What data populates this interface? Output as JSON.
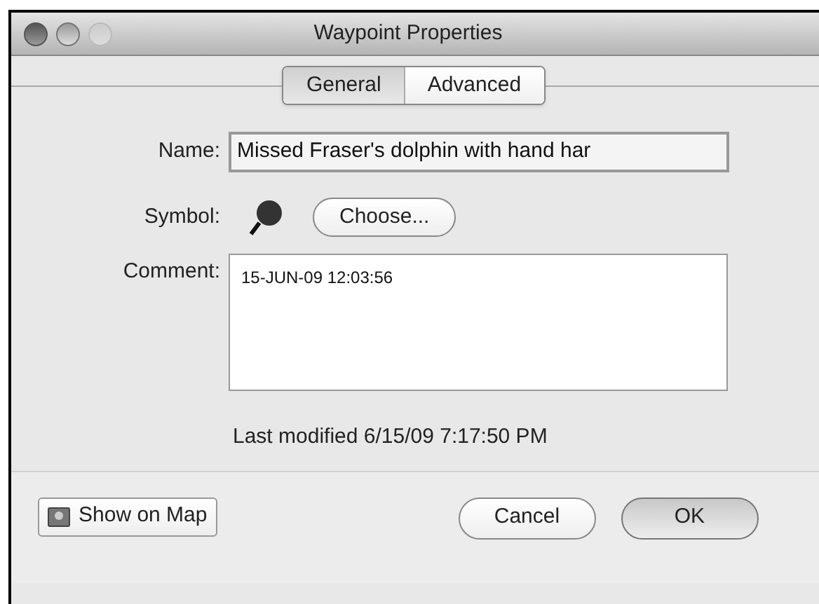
{
  "window": {
    "title": "Waypoint Properties"
  },
  "tabs": [
    {
      "label": "General",
      "selected": true
    },
    {
      "label": "Advanced",
      "selected": false
    }
  ],
  "name": {
    "label": "Name:",
    "value": "Missed Fraser's dolphin with hand har"
  },
  "symbol": {
    "label": "Symbol:",
    "button": "Choose..."
  },
  "comment": {
    "label": "Comment:",
    "value": "15-JUN-09 12:03:56"
  },
  "last_modified": "Last modified 6/15/09 7:17:50 PM",
  "buttons": {
    "show_on_map": "Show on Map",
    "cancel": "Cancel",
    "ok": "OK"
  }
}
